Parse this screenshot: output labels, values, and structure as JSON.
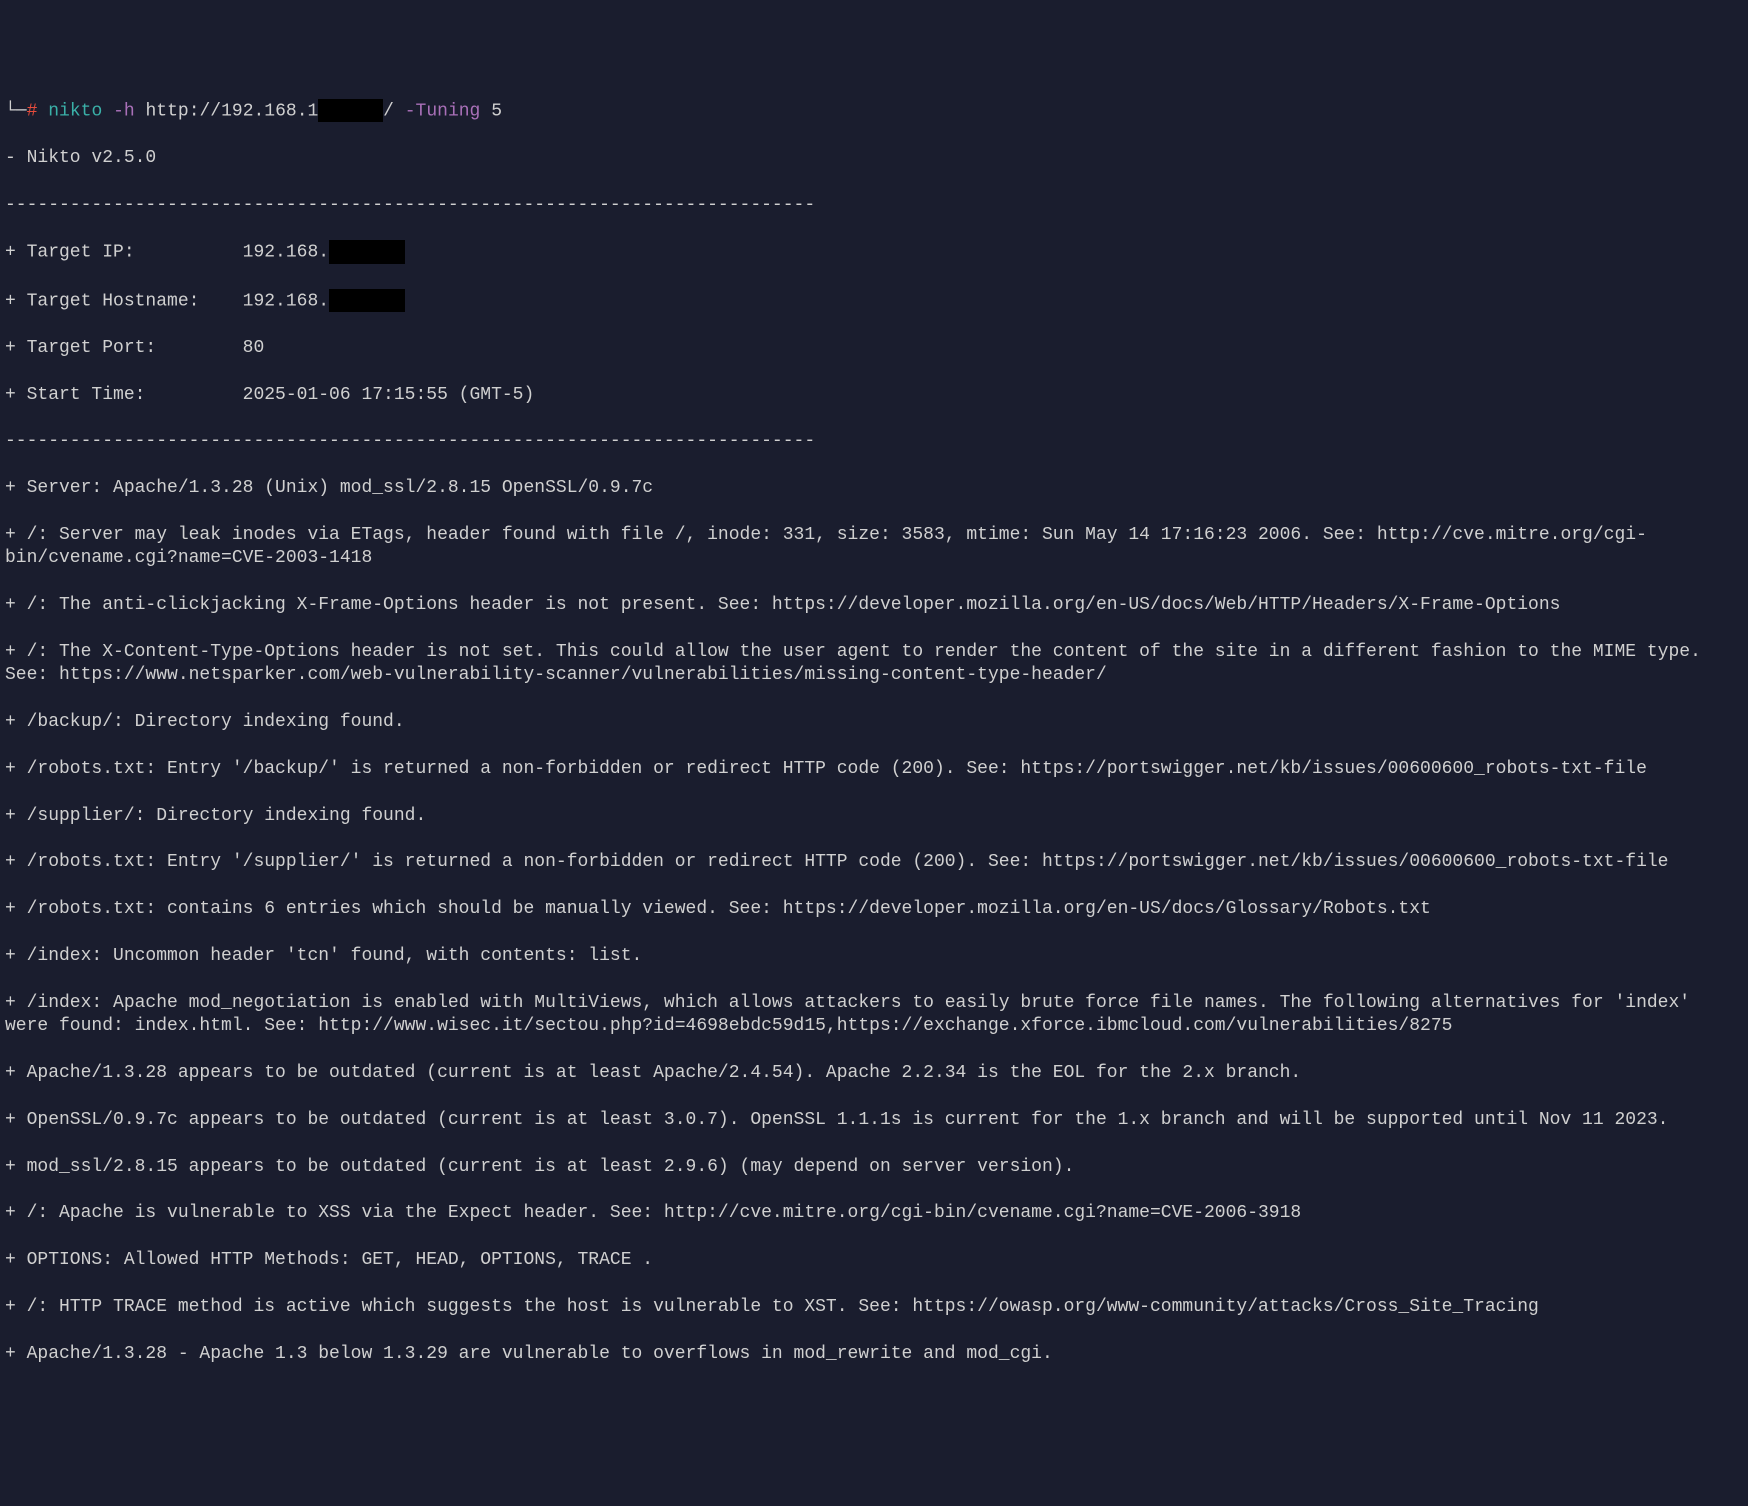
{
  "prompt": {
    "prefix": "└─",
    "hash": "#",
    "cmd_name": "nikto",
    "flag_h": "-h",
    "url_prefix": "http://192.168.1",
    "url_suffix": "/",
    "flag_tuning": "-Tuning",
    "tuning_val": "5"
  },
  "header": {
    "version": "- Nikto v2.5.0",
    "divider": "---------------------------------------------------------------------------",
    "target_ip_label": "+ Target IP:          192.168.",
    "target_hostname_label": "+ Target Hostname:    192.168.",
    "target_port": "+ Target Port:        80",
    "start_time": "+ Start Time:         2025-01-06 17:15:55 (GMT-5)"
  },
  "findings": [
    "+ Server: Apache/1.3.28 (Unix) mod_ssl/2.8.15 OpenSSL/0.9.7c",
    "+ /: Server may leak inodes via ETags, header found with file /, inode: 331, size: 3583, mtime: Sun May 14 17:16:23 2006. See: http://cve.mitre.org/cgi-bin/cvename.cgi?name=CVE-2003-1418",
    "+ /: The anti-clickjacking X-Frame-Options header is not present. See: https://developer.mozilla.org/en-US/docs/Web/HTTP/Headers/X-Frame-Options",
    "+ /: The X-Content-Type-Options header is not set. This could allow the user agent to render the content of the site in a different fashion to the MIME type. See: https://www.netsparker.com/web-vulnerability-scanner/vulnerabilities/missing-content-type-header/",
    "+ /backup/: Directory indexing found.",
    "+ /robots.txt: Entry '/backup/' is returned a non-forbidden or redirect HTTP code (200). See: https://portswigger.net/kb/issues/00600600_robots-txt-file",
    "+ /supplier/: Directory indexing found.",
    "+ /robots.txt: Entry '/supplier/' is returned a non-forbidden or redirect HTTP code (200). See: https://portswigger.net/kb/issues/00600600_robots-txt-file",
    "+ /robots.txt: contains 6 entries which should be manually viewed. See: https://developer.mozilla.org/en-US/docs/Glossary/Robots.txt",
    "+ /index: Uncommon header 'tcn' found, with contents: list.",
    "+ /index: Apache mod_negotiation is enabled with MultiViews, which allows attackers to easily brute force file names. The following alternatives for 'index' were found: index.html. See: http://www.wisec.it/sectou.php?id=4698ebdc59d15,https://exchange.xforce.ibmcloud.com/vulnerabilities/8275",
    "+ Apache/1.3.28 appears to be outdated (current is at least Apache/2.4.54). Apache 2.2.34 is the EOL for the 2.x branch.",
    "+ OpenSSL/0.9.7c appears to be outdated (current is at least 3.0.7). OpenSSL 1.1.1s is current for the 1.x branch and will be supported until Nov 11 2023.",
    "+ mod_ssl/2.8.15 appears to be outdated (current is at least 2.9.6) (may depend on server version).",
    "+ /: Apache is vulnerable to XSS via the Expect header. See: http://cve.mitre.org/cgi-bin/cvename.cgi?name=CVE-2006-3918",
    "+ OPTIONS: Allowed HTTP Methods: GET, HEAD, OPTIONS, TRACE .",
    "+ /: HTTP TRACE method is active which suggests the host is vulnerable to XST. See: https://owasp.org/www-community/attacks/Cross_Site_Tracing",
    "+ Apache/1.3.28 - Apache 1.3 below 1.3.29 are vulnerable to overflows in mod_rewrite and mod_cgi."
  ]
}
